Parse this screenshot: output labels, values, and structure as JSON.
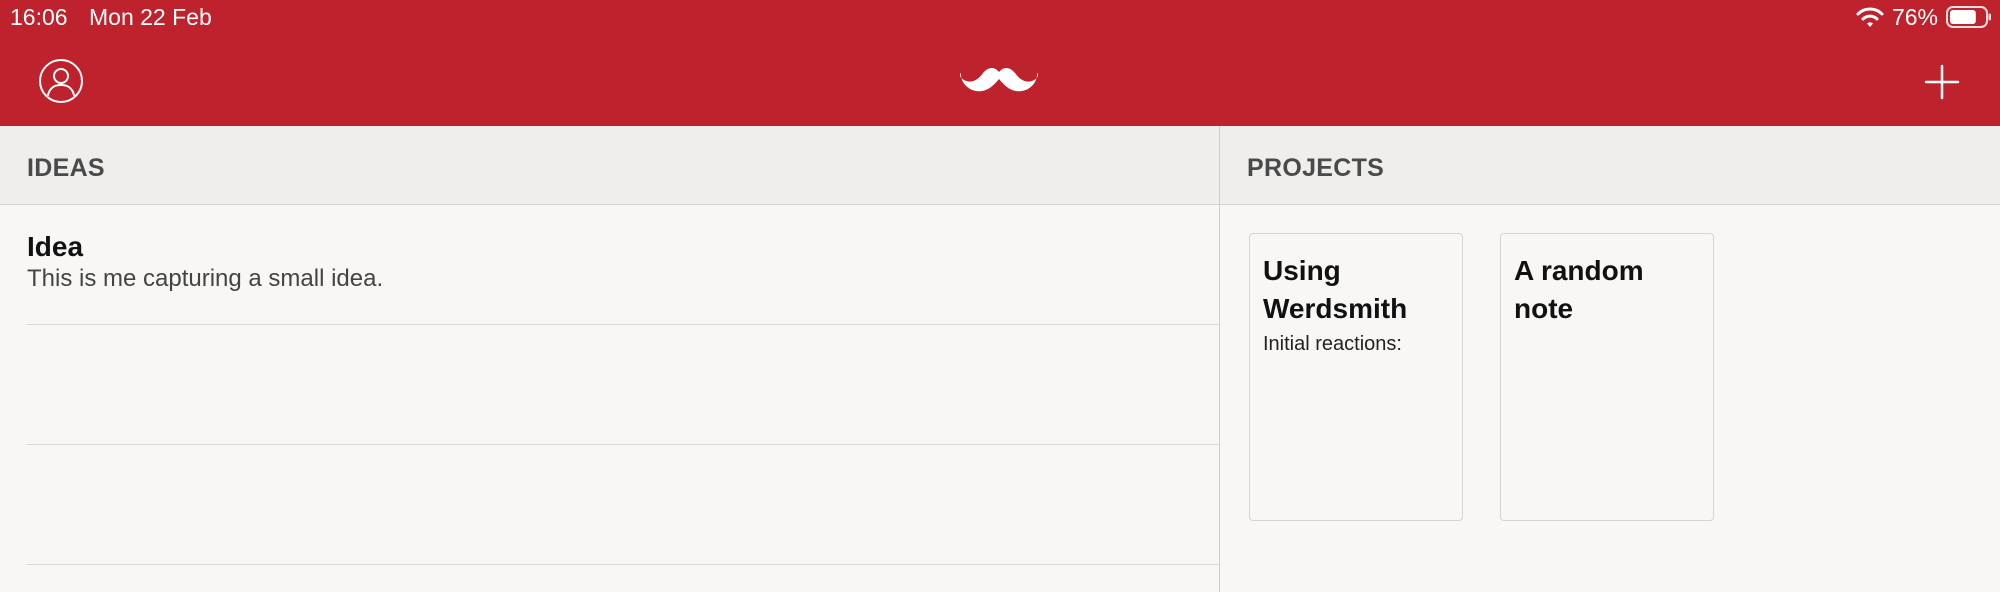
{
  "status_bar": {
    "time": "16:06",
    "date": "Mon 22 Feb",
    "battery_percent": "76%",
    "battery_level": 0.76,
    "icons": [
      "wifi-icon",
      "battery-icon"
    ]
  },
  "header": {
    "background_color": "#be222d",
    "left_icon": "profile-icon",
    "center_icon": "mustache-logo-icon",
    "right_icon": "plus-icon"
  },
  "ideas": {
    "title": "IDEAS",
    "items": [
      {
        "title": "Idea",
        "body": "This is me capturing a small idea."
      },
      {
        "title": "",
        "body": ""
      },
      {
        "title": "",
        "body": ""
      }
    ]
  },
  "projects": {
    "title": "PROJECTS",
    "cards": [
      {
        "title": "Using Werdsmith",
        "body": "Initial reactions:"
      },
      {
        "title": "A random note",
        "body": ""
      }
    ]
  }
}
